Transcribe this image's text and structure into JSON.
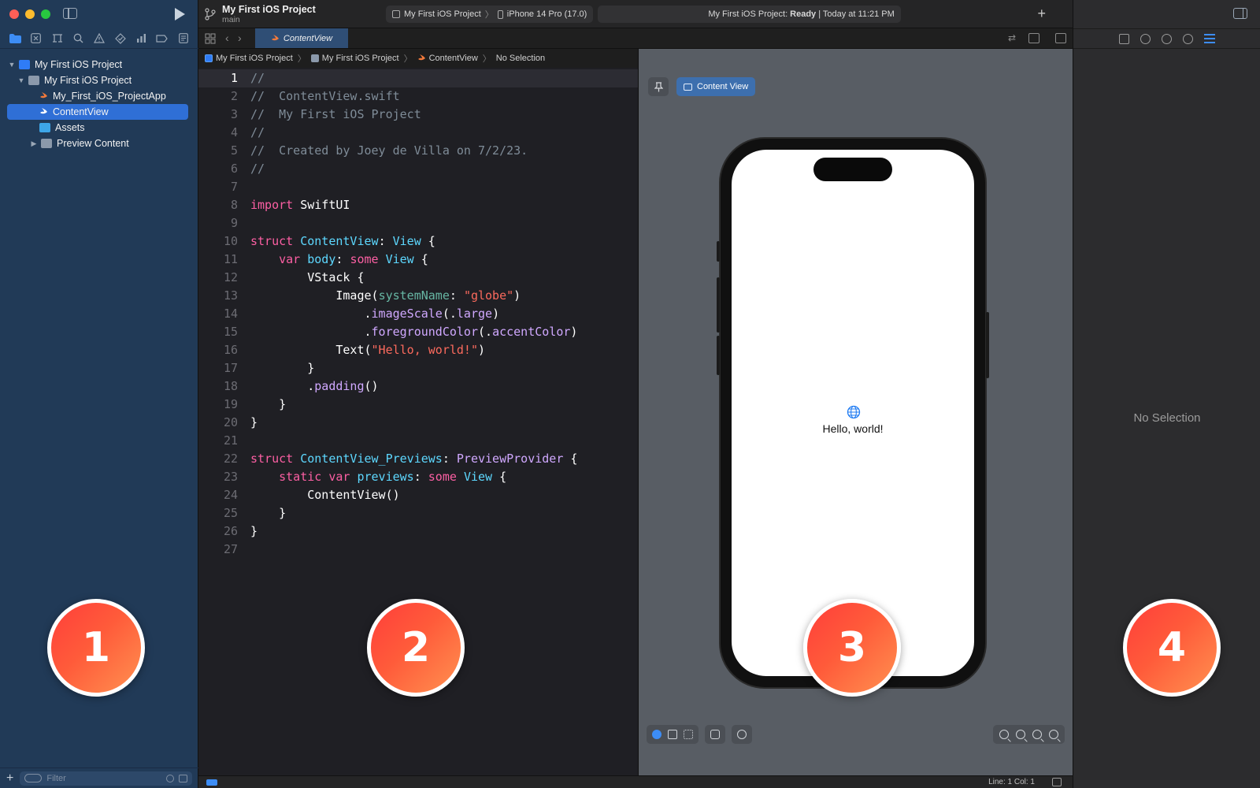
{
  "window": {
    "project_title": "My First iOS Project",
    "branch": "main"
  },
  "scheme": {
    "project": "My First iOS Project",
    "device": "iPhone 14 Pro (17.0)"
  },
  "status": {
    "prefix": "My First iOS Project:",
    "state": "Ready",
    "time": "| Today at 11:21 PM"
  },
  "navigator": {
    "tabs": [
      "folder-icon",
      "source-control-icon",
      "symbol-icon",
      "search-icon",
      "issue-icon",
      "test-icon",
      "debug-icon",
      "breakpoint-icon",
      "report-icon"
    ],
    "items": [
      {
        "label": "My First iOS Project",
        "icon": "xcode-project-icon",
        "disclosure": "expanded"
      },
      {
        "label": "My First iOS Project",
        "icon": "group-folder-icon",
        "disclosure": "expanded"
      },
      {
        "label": "My_First_iOS_ProjectApp",
        "icon": "swift-file-icon"
      },
      {
        "label": "ContentView",
        "icon": "swift-file-icon",
        "selected": true
      },
      {
        "label": "Assets",
        "icon": "asset-catalog-icon"
      },
      {
        "label": "Preview Content",
        "icon": "group-folder-icon",
        "disclosure": "collapsed"
      }
    ],
    "filter_placeholder": "Filter"
  },
  "editor": {
    "tab_label": "ContentView",
    "breadcrumb": [
      "My First iOS Project",
      "My First iOS Project",
      "ContentView",
      "No Selection"
    ],
    "current_line": 1,
    "line_numbers": [
      "1",
      "2",
      "3",
      "4",
      "5",
      "6",
      "7",
      "8",
      "9",
      "10",
      "11",
      "12",
      "13",
      "14",
      "15",
      "16",
      "17",
      "18",
      "19",
      "20",
      "21",
      "22",
      "23",
      "24",
      "25",
      "26",
      "27"
    ],
    "lines": [
      [
        [
          "c-com",
          "//"
        ]
      ],
      [
        [
          "c-com",
          "//  ContentView.swift"
        ]
      ],
      [
        [
          "c-com",
          "//  My First iOS Project"
        ]
      ],
      [
        [
          "c-com",
          "//"
        ]
      ],
      [
        [
          "c-com",
          "//  Created by Joey de Villa on 7/2/23."
        ]
      ],
      [
        [
          "c-com",
          "//"
        ]
      ],
      [],
      [
        [
          "c-kw",
          "import"
        ],
        [
          "",
          " SwiftUI"
        ]
      ],
      [],
      [
        [
          "c-kw",
          "struct"
        ],
        [
          "",
          " "
        ],
        [
          "c-type",
          "ContentView"
        ],
        [
          "",
          ": "
        ],
        [
          "c-type",
          "View"
        ],
        [
          "",
          " {"
        ]
      ],
      [
        [
          "",
          "    "
        ],
        [
          "c-kw",
          "var"
        ],
        [
          "",
          " "
        ],
        [
          "c-type",
          "body"
        ],
        [
          "",
          ": "
        ],
        [
          "c-kw",
          "some"
        ],
        [
          "",
          " "
        ],
        [
          "c-type",
          "View"
        ],
        [
          "",
          " {"
        ]
      ],
      [
        [
          "",
          "        VStack {"
        ]
      ],
      [
        [
          "",
          "            Image("
        ],
        [
          "c-fn",
          "systemName"
        ],
        [
          "",
          ": "
        ],
        [
          "c-str",
          "\"globe\""
        ],
        [
          "",
          ")"
        ]
      ],
      [
        [
          "",
          "                ."
        ],
        [
          "c-id",
          "imageScale"
        ],
        [
          "",
          "(."
        ],
        [
          "c-id",
          "large"
        ],
        [
          "",
          ")"
        ]
      ],
      [
        [
          "",
          "                ."
        ],
        [
          "c-id",
          "foregroundColor"
        ],
        [
          "",
          "(."
        ],
        [
          "c-id",
          "accentColor"
        ],
        [
          "",
          ")"
        ]
      ],
      [
        [
          "",
          "            Text("
        ],
        [
          "c-str",
          "\"Hello, world!\""
        ],
        [
          "",
          ")"
        ]
      ],
      [
        [
          "",
          "        }"
        ]
      ],
      [
        [
          "",
          "        ."
        ],
        [
          "c-id",
          "padding"
        ],
        [
          "",
          "()"
        ]
      ],
      [
        [
          "",
          "    }"
        ]
      ],
      [
        [
          "",
          "}"
        ]
      ],
      [],
      [
        [
          "c-kw",
          "struct"
        ],
        [
          "",
          " "
        ],
        [
          "c-type",
          "ContentView_Previews"
        ],
        [
          "",
          ": "
        ],
        [
          "c-id",
          "PreviewProvider"
        ],
        [
          "",
          " {"
        ]
      ],
      [
        [
          "",
          "    "
        ],
        [
          "c-kw",
          "static"
        ],
        [
          "",
          " "
        ],
        [
          "c-kw",
          "var"
        ],
        [
          "",
          " "
        ],
        [
          "c-type",
          "previews"
        ],
        [
          "",
          ": "
        ],
        [
          "c-kw",
          "some"
        ],
        [
          "",
          " "
        ],
        [
          "c-type",
          "View"
        ],
        [
          "",
          " {"
        ]
      ],
      [
        [
          "",
          "        ContentView()"
        ]
      ],
      [
        [
          "",
          "    }"
        ]
      ],
      [
        [
          "",
          "}"
        ]
      ],
      []
    ]
  },
  "canvas": {
    "preview_tab": "Content View",
    "device_screen_text": "Hello, world!"
  },
  "inspector": {
    "empty_label": "No Selection"
  },
  "statusbar": {
    "cursor": "Line: 1  Col: 1"
  },
  "callouts": [
    "1",
    "2",
    "3",
    "4"
  ],
  "colors": {
    "navigator_bg": "#213a57",
    "selection": "#2f6fd6",
    "accent": "#3d8df5",
    "badge_start": "#ff3e3a",
    "badge_end": "#ff9150"
  }
}
